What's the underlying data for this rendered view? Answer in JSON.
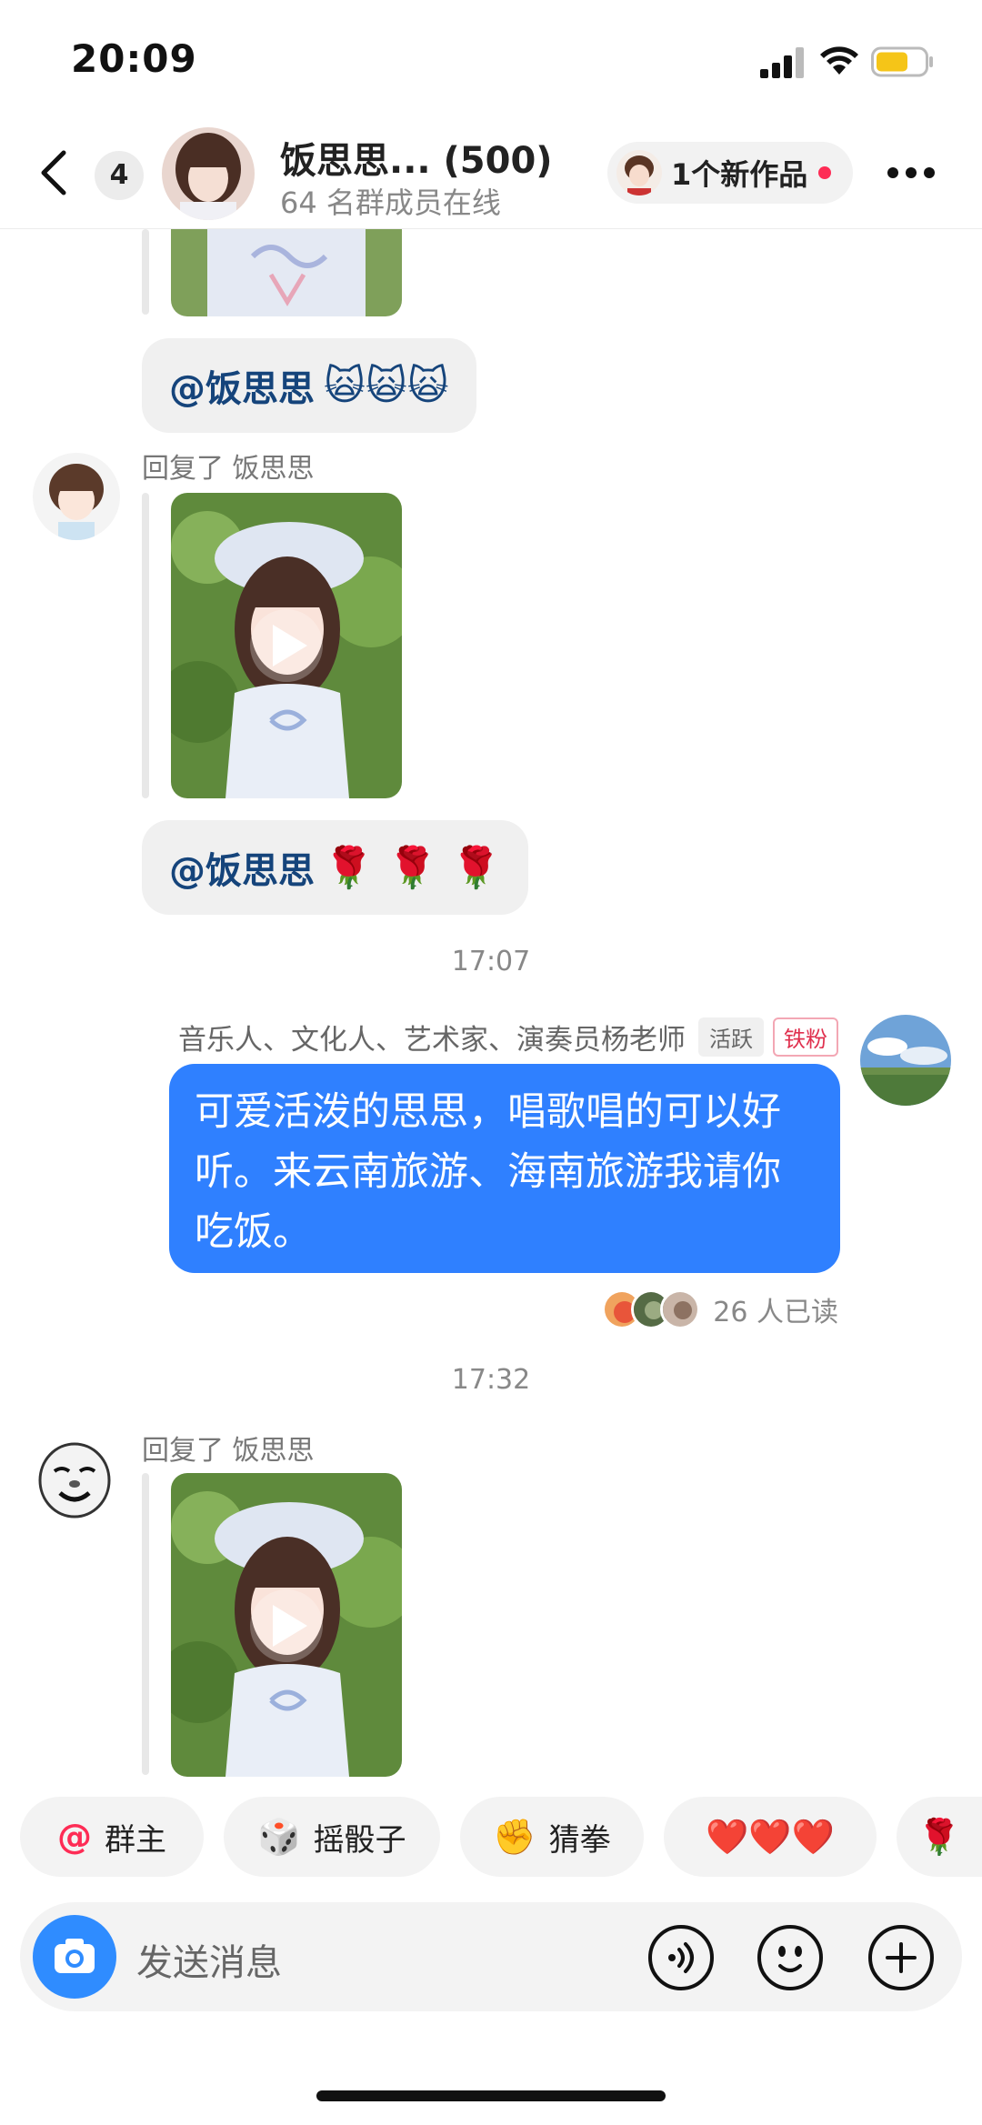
{
  "status_bar": {
    "time": "20:09"
  },
  "header": {
    "unread_count": "4",
    "group_name": "饭思思... (500)",
    "online_text": "64 名群成员在线",
    "new_works": "1个新作品"
  },
  "messages": {
    "mention_1": "@饭思思",
    "mention_1_emojis": "🙀🙀🙀",
    "reply_label_1": "回复了 饭思思",
    "mention_2": "@饭思思",
    "mention_2_emojis": "🌹 🌹 🌹",
    "time_1": "17:07",
    "sender_name": "音乐人、文化人、艺术家、演奏员杨老师",
    "tag_active": "活跃",
    "tag_fan": "铁粉",
    "blue_message": "可爱活泼的思思，唱歌唱的可以好听。来云南旅游、海南旅游我请你吃饭。",
    "read_count": "26 人已读",
    "time_2": "17:32",
    "reply_label_2": "回复了 饭思思"
  },
  "quick_replies": [
    {
      "icon": "@",
      "label": "群主"
    },
    {
      "icon": "🎲",
      "label": "摇骰子"
    },
    {
      "icon": "✊",
      "label": "猜拳"
    },
    {
      "icon": "",
      "label": "❤️❤️❤️"
    },
    {
      "icon": "🌹",
      "label": ""
    }
  ],
  "input": {
    "placeholder": "发送消息"
  },
  "colors": {
    "accent_blue": "#2f80ff",
    "mention_text": "#15447b",
    "badge_red": "#fe2c55"
  }
}
